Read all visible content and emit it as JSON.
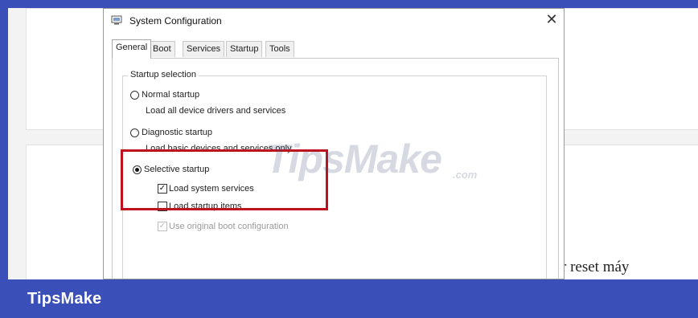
{
  "dialog": {
    "title": "System Configuration",
    "close_glyph": "✕",
    "tabs": [
      "General",
      "Boot",
      "Services",
      "Startup",
      "Tools"
    ],
    "active_tab": "General",
    "group_title": "Startup selection",
    "options": [
      {
        "label": "Normal startup",
        "description": "Load all device drivers and services",
        "selected": false
      },
      {
        "label": "Diagnostic startup",
        "description": "Load basic devices and services only",
        "selected": false
      },
      {
        "label": "Selective startup",
        "selected": true
      }
    ],
    "selective_options": [
      {
        "label": "Load system services",
        "checked": true,
        "enabled": true
      },
      {
        "label": "Load startup items",
        "checked": false,
        "enabled": true
      },
      {
        "label": "Use original boot configuration",
        "checked": true,
        "enabled": false
      }
    ]
  },
  "background_text": "r reset máy",
  "watermark": {
    "main": "TipsMake",
    "suffix": ".com"
  },
  "brand": "TipsMake",
  "colors": {
    "bar": "#3b4fb8",
    "highlight": "#c0111f"
  },
  "icons": {
    "app": "system-configuration-icon",
    "close": "close-icon",
    "check": "✓"
  }
}
